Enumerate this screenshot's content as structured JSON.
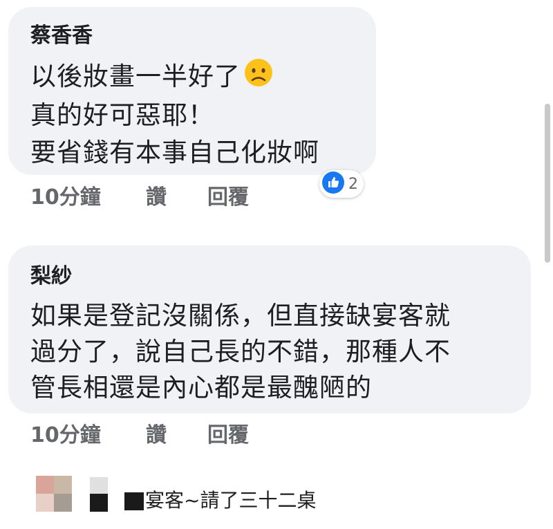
{
  "comments": [
    {
      "author": "蔡香香",
      "lines": [
        "以後妝畫一半好了",
        "真的好可惡耶！",
        "要省錢有本事自己化妝啊"
      ],
      "emoji": "worried-face-icon",
      "time": "10分鐘",
      "like_label": "讚",
      "reply_label": "回覆",
      "reaction_count": "2"
    },
    {
      "author": "梨紗",
      "lines": [
        "如果是登記沒關係，但直接缺宴客就",
        "過分了，說自己長的不錯，那種人不",
        "管長相還是內心都是最醜陋的"
      ],
      "time": "10分鐘",
      "like_label": "讚",
      "reply_label": "回覆"
    }
  ],
  "partial_reply": {
    "text": "宴客~請了三十二桌"
  },
  "colors": {
    "bubble": "#f0f2f5",
    "meta": "#65676b",
    "like_blue": "#1877f2"
  }
}
